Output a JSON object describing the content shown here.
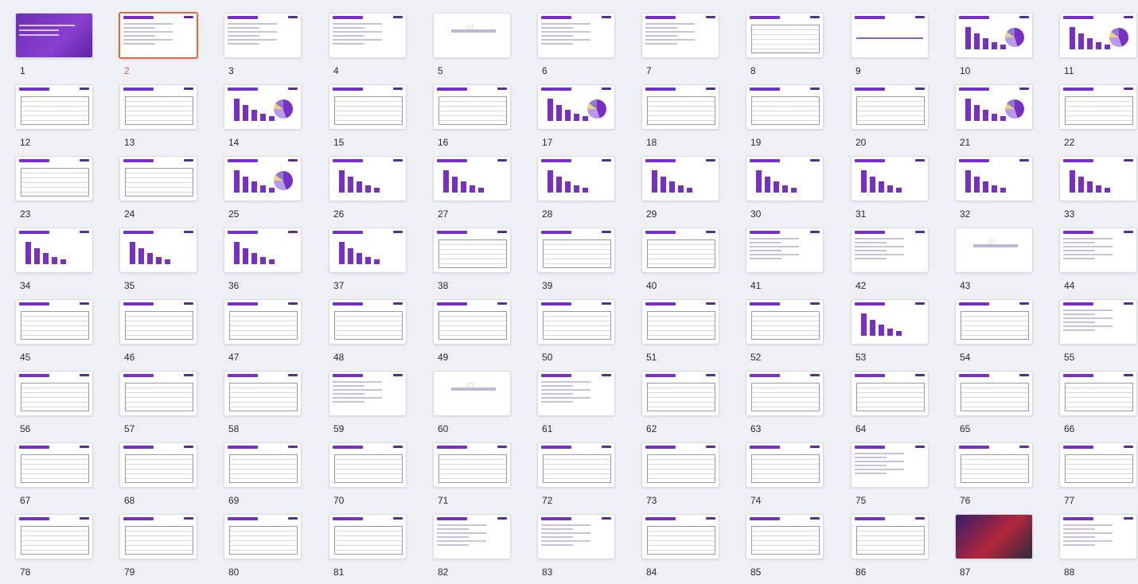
{
  "slides": [
    {
      "n": "1",
      "t": "cover"
    },
    {
      "n": "2",
      "t": "text",
      "selected": true
    },
    {
      "n": "3",
      "t": "text"
    },
    {
      "n": "4",
      "t": "text"
    },
    {
      "n": "5",
      "t": "section"
    },
    {
      "n": "6",
      "t": "text"
    },
    {
      "n": "7",
      "t": "text"
    },
    {
      "n": "8",
      "t": "table"
    },
    {
      "n": "9",
      "t": "line"
    },
    {
      "n": "10",
      "t": "barpie"
    },
    {
      "n": "11",
      "t": "barpie"
    },
    {
      "n": "12",
      "t": "table"
    },
    {
      "n": "13",
      "t": "table"
    },
    {
      "n": "14",
      "t": "barpie"
    },
    {
      "n": "15",
      "t": "table"
    },
    {
      "n": "16",
      "t": "table"
    },
    {
      "n": "17",
      "t": "barpie"
    },
    {
      "n": "18",
      "t": "table"
    },
    {
      "n": "19",
      "t": "table"
    },
    {
      "n": "20",
      "t": "table"
    },
    {
      "n": "21",
      "t": "barpie"
    },
    {
      "n": "22",
      "t": "table"
    },
    {
      "n": "23",
      "t": "table"
    },
    {
      "n": "24",
      "t": "table"
    },
    {
      "n": "25",
      "t": "barpie"
    },
    {
      "n": "26",
      "t": "bar"
    },
    {
      "n": "27",
      "t": "bar"
    },
    {
      "n": "28",
      "t": "bar"
    },
    {
      "n": "29",
      "t": "bar"
    },
    {
      "n": "30",
      "t": "bar"
    },
    {
      "n": "31",
      "t": "bar"
    },
    {
      "n": "32",
      "t": "bar"
    },
    {
      "n": "33",
      "t": "bar"
    },
    {
      "n": "34",
      "t": "bar"
    },
    {
      "n": "35",
      "t": "bar"
    },
    {
      "n": "36",
      "t": "bar"
    },
    {
      "n": "37",
      "t": "bar"
    },
    {
      "n": "38",
      "t": "table"
    },
    {
      "n": "39",
      "t": "table"
    },
    {
      "n": "40",
      "t": "table"
    },
    {
      "n": "41",
      "t": "text"
    },
    {
      "n": "42",
      "t": "text"
    },
    {
      "n": "43",
      "t": "section"
    },
    {
      "n": "44",
      "t": "text"
    },
    {
      "n": "45",
      "t": "table"
    },
    {
      "n": "46",
      "t": "table"
    },
    {
      "n": "47",
      "t": "table"
    },
    {
      "n": "48",
      "t": "table"
    },
    {
      "n": "49",
      "t": "table"
    },
    {
      "n": "50",
      "t": "table"
    },
    {
      "n": "51",
      "t": "table"
    },
    {
      "n": "52",
      "t": "table"
    },
    {
      "n": "53",
      "t": "bar"
    },
    {
      "n": "54",
      "t": "table"
    },
    {
      "n": "55",
      "t": "text"
    },
    {
      "n": "56",
      "t": "table"
    },
    {
      "n": "57",
      "t": "table"
    },
    {
      "n": "58",
      "t": "table"
    },
    {
      "n": "59",
      "t": "text"
    },
    {
      "n": "60",
      "t": "section"
    },
    {
      "n": "61",
      "t": "text"
    },
    {
      "n": "62",
      "t": "table"
    },
    {
      "n": "63",
      "t": "table"
    },
    {
      "n": "64",
      "t": "table"
    },
    {
      "n": "65",
      "t": "table"
    },
    {
      "n": "66",
      "t": "table"
    },
    {
      "n": "67",
      "t": "table"
    },
    {
      "n": "68",
      "t": "table"
    },
    {
      "n": "69",
      "t": "table"
    },
    {
      "n": "70",
      "t": "table"
    },
    {
      "n": "71",
      "t": "table"
    },
    {
      "n": "72",
      "t": "table"
    },
    {
      "n": "73",
      "t": "table"
    },
    {
      "n": "74",
      "t": "table"
    },
    {
      "n": "75",
      "t": "text"
    },
    {
      "n": "76",
      "t": "table"
    },
    {
      "n": "77",
      "t": "table"
    },
    {
      "n": "78",
      "t": "table"
    },
    {
      "n": "79",
      "t": "table"
    },
    {
      "n": "80",
      "t": "table"
    },
    {
      "n": "81",
      "t": "table"
    },
    {
      "n": "82",
      "t": "text"
    },
    {
      "n": "83",
      "t": "text"
    },
    {
      "n": "84",
      "t": "table"
    },
    {
      "n": "85",
      "t": "table"
    },
    {
      "n": "86",
      "t": "table"
    },
    {
      "n": "87",
      "t": "dark"
    },
    {
      "n": "88",
      "t": "text"
    }
  ],
  "section_numbers": {
    "5": "01",
    "43": "02",
    "60": "03"
  },
  "colors": {
    "accent": "#7a2fc4",
    "selected": "#e06a3a",
    "background": "#eef0f6"
  }
}
